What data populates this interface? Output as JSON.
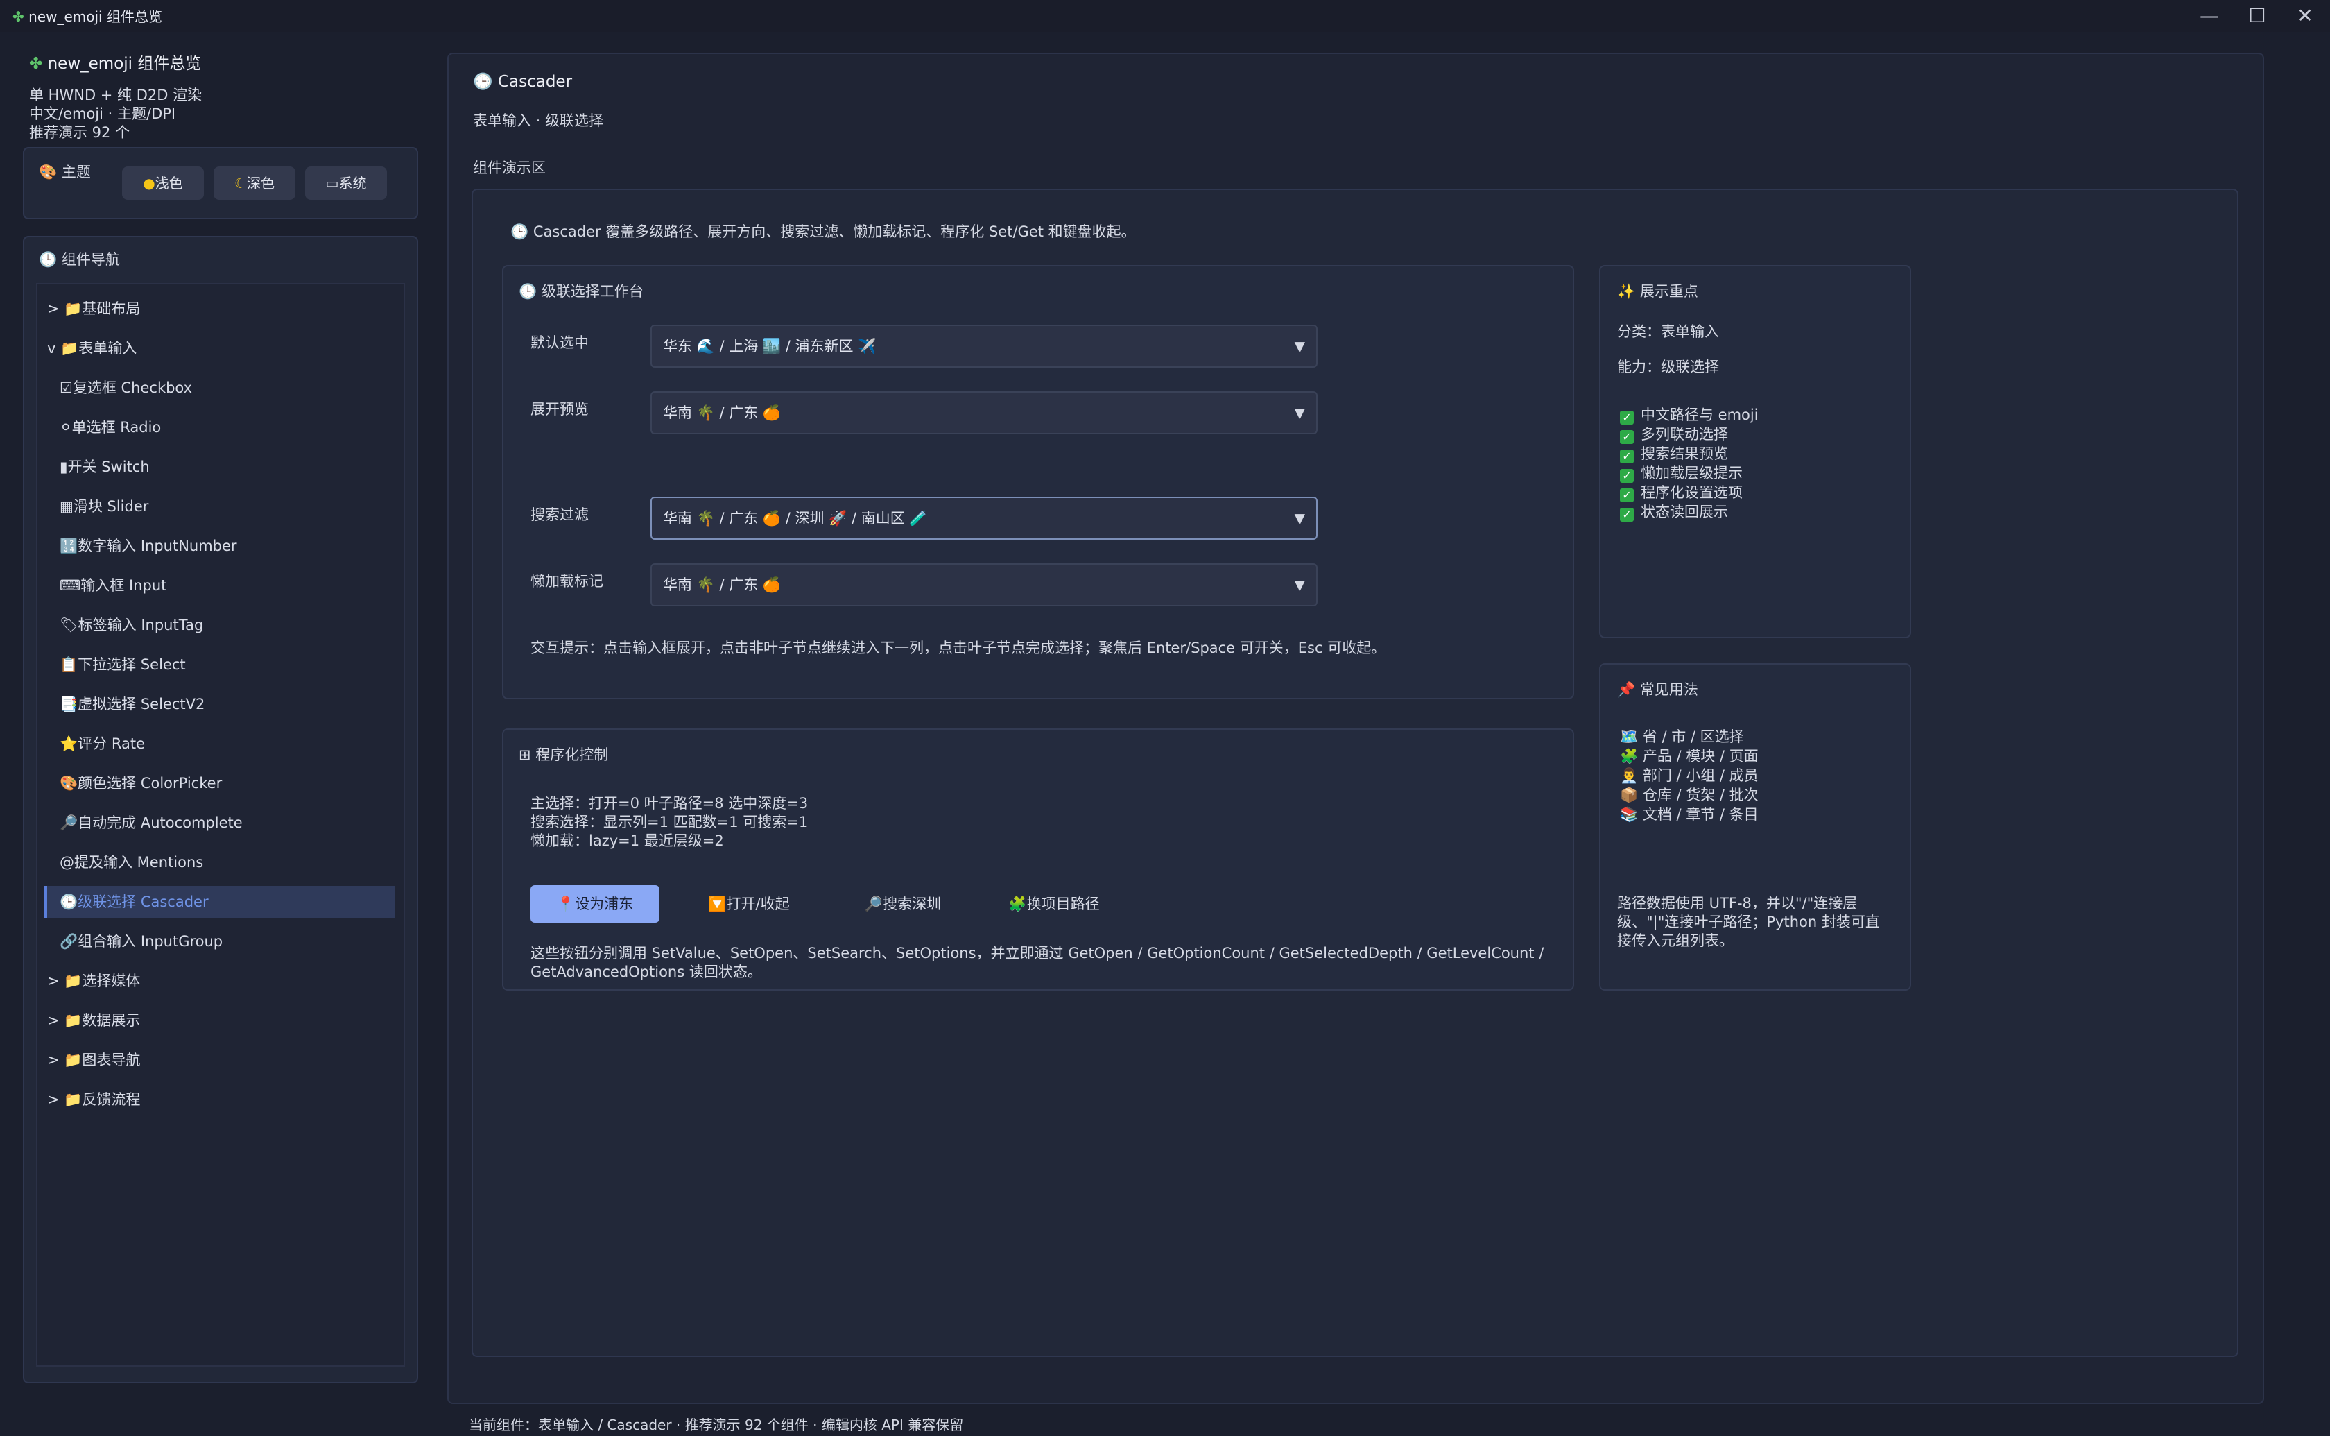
{
  "window": {
    "title": "new_emoji 组件总览",
    "icon": "puzzle-icon",
    "controls": {
      "minimize": "—",
      "maximize": "☐",
      "close": "✕"
    }
  },
  "sidebar": {
    "app_title": "new_emoji 组件总览",
    "meta_lines": [
      "单 HWND + 纯 D2D 渲染",
      "中文/emoji · 主题/DPI",
      "推荐演示 92 个"
    ],
    "theme": {
      "title": "主题",
      "buttons": [
        {
          "label": "浅色",
          "icon": "sun-icon"
        },
        {
          "label": "深色",
          "icon": "moon-icon"
        },
        {
          "label": "系统",
          "icon": "monitor-icon"
        }
      ]
    },
    "nav": {
      "title": "组件导航",
      "items": [
        {
          "label": "> 📁基础布局",
          "level": 0
        },
        {
          "label": "v 📁表单输入",
          "level": 0
        },
        {
          "label": "☑复选框 Checkbox",
          "level": 1
        },
        {
          "label": "⚪单选框 Radio",
          "level": 1
        },
        {
          "label": "▮开关 Switch",
          "level": 1
        },
        {
          "label": "▦滑块 Slider",
          "level": 1
        },
        {
          "label": "🔢数字输入 InputNumber",
          "level": 1
        },
        {
          "label": "⌨输入框 Input",
          "level": 1
        },
        {
          "label": "🏷标签输入 InputTag",
          "level": 1
        },
        {
          "label": "📋下拉选择 Select",
          "level": 1
        },
        {
          "label": "📑虚拟选择 SelectV2",
          "level": 1
        },
        {
          "label": "⭐评分 Rate",
          "level": 1
        },
        {
          "label": "🎨颜色选择 ColorPicker",
          "level": 1
        },
        {
          "label": "🔎自动完成 Autocomplete",
          "level": 1
        },
        {
          "label": "@提及输入 Mentions",
          "level": 1
        },
        {
          "label": "🕒级联选择 Cascader",
          "level": 1,
          "active": true
        },
        {
          "label": "🔗组合输入 InputGroup",
          "level": 1
        },
        {
          "label": "> 📁选择媒体",
          "level": 0
        },
        {
          "label": "> 📁数据展示",
          "level": 0
        },
        {
          "label": "> 📁图表导航",
          "level": 0
        },
        {
          "label": "> 📁反馈流程",
          "level": 0
        }
      ]
    }
  },
  "main": {
    "title": "Cascader",
    "subtitle": "表单输入 · 级联选择",
    "demo_area_label": "组件演示区",
    "intro": "Cascader 覆盖多级路径、展开方向、搜索过滤、懒加载标记、程序化 Set/Get 和键盘收起。",
    "workbench": {
      "title": "级联选择工作台",
      "rows": [
        {
          "label": "默认选中",
          "value": "华东 🌊 / 上海 🏙️ / 浦东新区 ✈️"
        },
        {
          "label": "展开预览",
          "value": "华南 🌴 / 广东 🍊"
        },
        {
          "label": "搜索过滤",
          "value": "华南 🌴 / 广东 🍊 / 深圳 🚀 / 南山区 🧪"
        },
        {
          "label": "懒加载标记",
          "value": "华南 🌴 / 广东 🍊"
        }
      ],
      "hint": "交互提示：点击输入框展开，点击非叶子节点继续进入下一列，点击叶子节点完成选择；聚焦后 Enter/Space 可开关，Esc 可收起。"
    },
    "program": {
      "title": "程序化控制",
      "status_lines": [
        "主选择：打开=0 叶子路径=8 选中深度=3",
        "搜索选择：显示列=1 匹配数=1 可搜索=1",
        "懒加载：lazy=1 最近层级=2"
      ],
      "buttons": [
        {
          "label": "📍设为浦东"
        },
        {
          "label": "🔽打开/收起"
        },
        {
          "label": "🔎搜索深圳"
        },
        {
          "label": "🧩换项目路径"
        }
      ],
      "note_lines": [
        "这些按钮分别调用 SetValue、SetOpen、SetSearch、SetOptions，并立即通过 GetOpen / GetOptionCount / GetSelectedDepth / GetLevelCount /",
        "GetAdvancedOptions 读回状态。"
      ]
    },
    "highlights": {
      "title": "展示重点",
      "category": "分类：表单输入",
      "ability": "能力：级联选择",
      "checks": [
        "中文路径与 emoji",
        "多列联动选择",
        "搜索结果预览",
        "懒加载层级提示",
        "程序化设置选项",
        "状态读回展示"
      ]
    },
    "usage": {
      "title": "常见用法",
      "items": [
        "🗺️ 省 / 市 / 区选择",
        "🧩 产品 / 模块 / 页面",
        "👨‍💼 部门 / 小组 / 成员",
        "📦 仓库 / 货架 / 批次",
        "📚 文档 / 章节 / 条目"
      ],
      "note_lines": [
        "路径数据使用 UTF-8，并以\"/\"连接层",
        "级、\"|\"连接叶子路径；Python 封装可直",
        "接传入元组列表。"
      ]
    }
  },
  "status_bar": "当前组件：表单输入 / Cascader · 推荐演示 92 个组件 · 编辑内核 API 兼容保留",
  "colors": {
    "accent": "#8aa8f5",
    "active_nav": "#6f93e6",
    "background": "#1b1f2d",
    "check": "#2eaa47"
  }
}
